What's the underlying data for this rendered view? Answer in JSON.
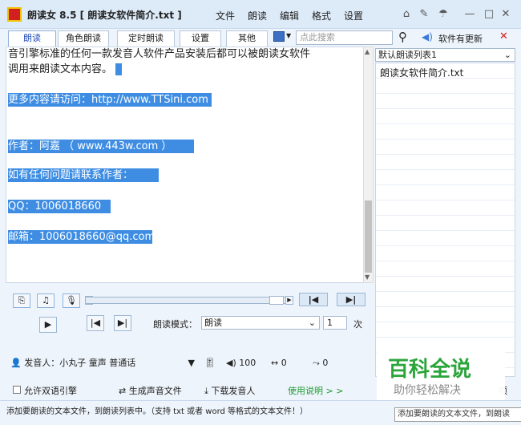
{
  "title": {
    "app": "朗读女 8.5",
    "file": "[ 朗读女软件简介.txt ]"
  },
  "menu": [
    "文件",
    "朗读",
    "编辑",
    "格式",
    "设置"
  ],
  "tabs": [
    "朗读",
    "角色朗读",
    "定时朗读",
    "设置",
    "其他"
  ],
  "search": {
    "placeholder": "点此搜索"
  },
  "update_label": "软件有更新",
  "text_lines": [
    "音引擎标准的任何一款发音人软件产品安装后都可以被朗读女软件",
    "调用来朗读文本内容。",
    "",
    "更多内容请访问：http://www.TTSini.com",
    "",
    "",
    "作者：阿嘉   （ www.443w.com ）",
    "",
    "如有任何问题请联系作者：",
    "",
    "QQ：1006018660",
    "",
    "邮箱：1006018660@qq.com"
  ],
  "list": {
    "selected": "默认朗读列表1",
    "items": [
      "朗读女软件简介.txt"
    ]
  },
  "controls": {
    "mode_label": "朗读模式：",
    "mode_value": "朗读",
    "count_value": "1",
    "count_suffix": "次",
    "voice": "发音人：小丸子 童声 普通话",
    "volume": "100",
    "speed": "0",
    "pitch": "0",
    "bilingual": "允许双语引擎",
    "gen_sound": "生成声音文件",
    "download_voice": "下载发音人",
    "help_link": "使用说明 > >",
    "truncated": "项"
  },
  "status": "添加要朗读的文本文件，到朗读列表中。（支持 txt 或者 word 等格式的文本文件！）",
  "tooltip": "添加要朗读的文本文件，到朗读",
  "watermark": {
    "title": "百科全说",
    "subtitle": "助你轻松解决"
  },
  "colors": {
    "accent": "#2250b8",
    "selection": "#3e8de3",
    "brand_green": "#2aa53a",
    "close_red": "#d21f1f"
  }
}
